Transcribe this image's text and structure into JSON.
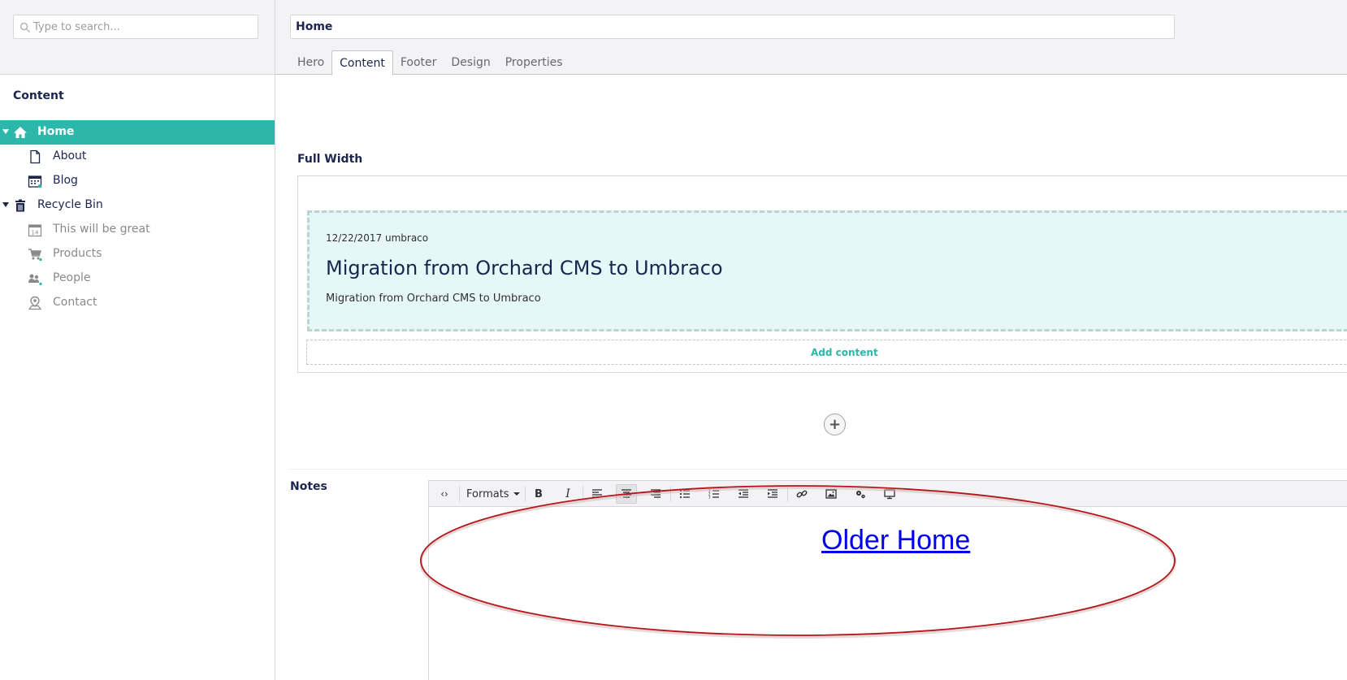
{
  "search": {
    "placeholder": "Type to search..."
  },
  "tree": {
    "title": "Content",
    "items": [
      {
        "label": "Home"
      },
      {
        "label": "About"
      },
      {
        "label": "Blog"
      },
      {
        "label": "Recycle Bin"
      },
      {
        "label": "This will be great"
      },
      {
        "label": "Products"
      },
      {
        "label": "People"
      },
      {
        "label": "Contact"
      }
    ]
  },
  "editor": {
    "name": "Home",
    "tabs": [
      {
        "label": "Hero"
      },
      {
        "label": "Content"
      },
      {
        "label": "Footer"
      },
      {
        "label": "Design"
      },
      {
        "label": "Properties"
      }
    ],
    "active_tab": "Content"
  },
  "grid": {
    "section_label": "Full Width",
    "cell": {
      "meta": "12/22/2017 umbraco",
      "title": "Migration from Orchard CMS to Umbraco",
      "summary": "Migration from Orchard CMS to Umbraco"
    },
    "add_content": "Add content",
    "add_row": "+"
  },
  "notes": {
    "label": "Notes",
    "toolbar": {
      "source": "‹›",
      "formats": "Formats",
      "bold": "B",
      "italic": "I"
    },
    "link_text": "Older Home"
  },
  "colors": {
    "accent": "#2bb7aa",
    "cell_bg": "#e5f7f6",
    "annotation": "#b5161b",
    "link": "#0000ee"
  }
}
